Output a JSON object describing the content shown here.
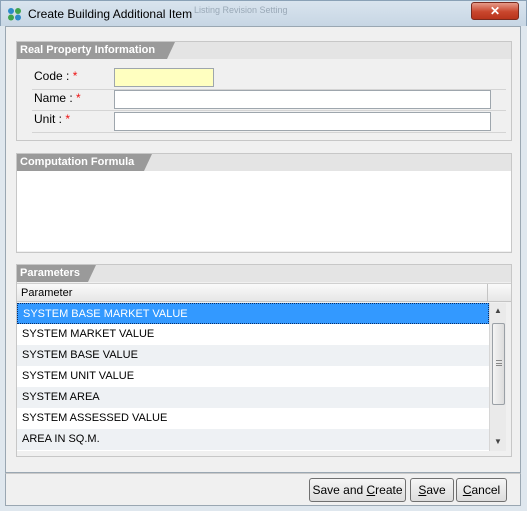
{
  "window": {
    "title": "Create Building Additional Item",
    "background_title": "Listing Revision Setting",
    "close_glyph": "✕",
    "app_icon": "app-logo-icon"
  },
  "real_property": {
    "section_title": "Real Property Information",
    "code_label": "Code :",
    "name_label": "Name :",
    "unit_label": "Unit :",
    "required_mark": "*",
    "code_value": "",
    "name_value": "",
    "unit_value": ""
  },
  "formula": {
    "section_title": "Computation Formula",
    "value": ""
  },
  "parameters": {
    "section_title": "Parameters",
    "column_header": "Parameter",
    "rows": [
      "SYSTEM BASE MARKET VALUE",
      "SYSTEM MARKET VALUE",
      "SYSTEM BASE VALUE",
      "SYSTEM UNIT VALUE",
      "SYSTEM AREA",
      "SYSTEM ASSESSED VALUE",
      "AREA IN SQ.M."
    ],
    "selected_index": 0
  },
  "buttons": {
    "save_and_create_pre": "Save and ",
    "save_and_create_u": "C",
    "save_and_create_post": "reate",
    "save_u": "S",
    "save_post": "ave",
    "cancel_u": "C",
    "cancel_post": "ancel"
  },
  "colors": {
    "selection": "#3399ff",
    "required": "#ee1111",
    "code_field_bg": "#ffffc0",
    "close_button": "#c9462d"
  }
}
